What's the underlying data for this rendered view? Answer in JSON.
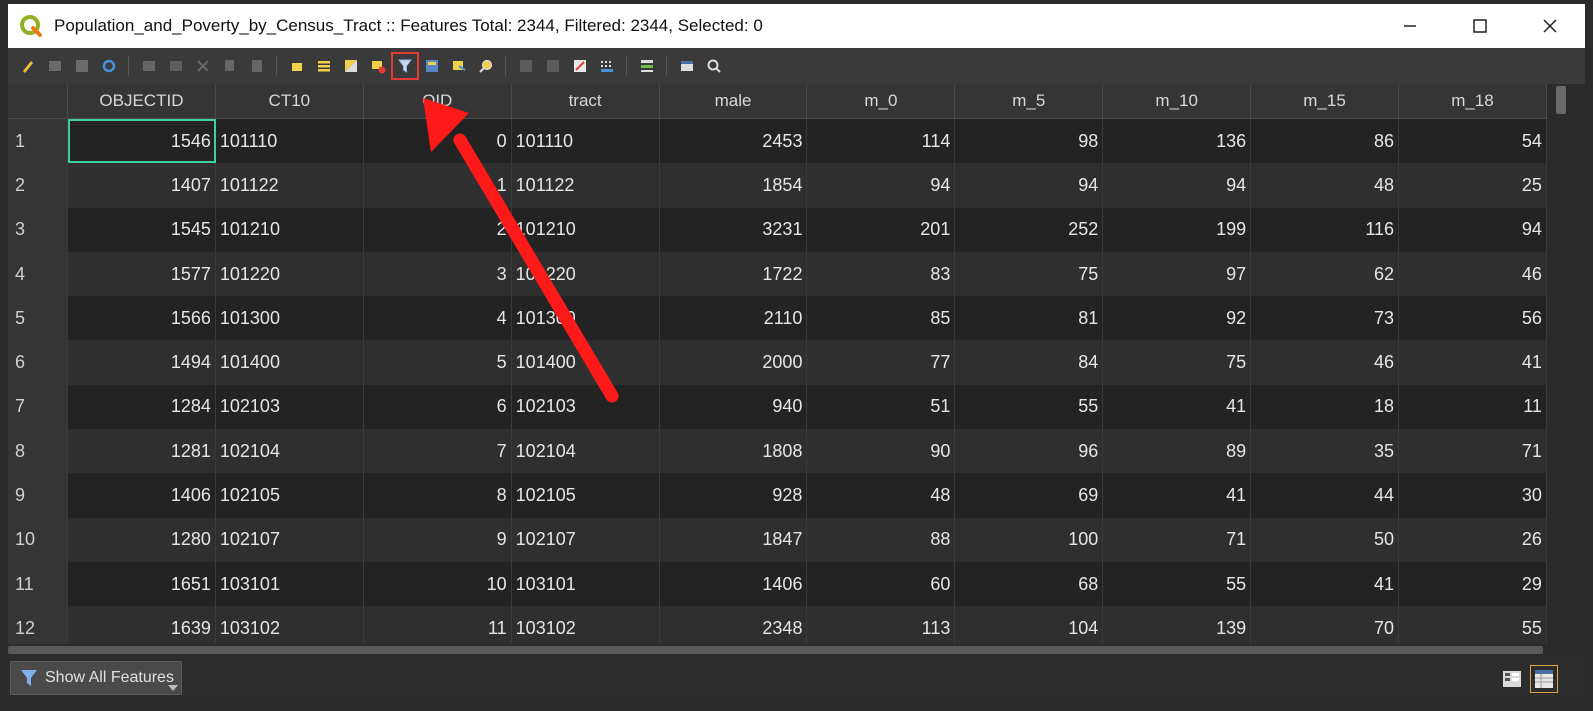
{
  "window": {
    "title": "Population_and_Poverty_by_Census_Tract :: Features Total: 2344, Filtered: 2344, Selected: 0",
    "app_icon": "qgis-icon",
    "controls": [
      "minimize-icon",
      "maximize-icon",
      "close-icon"
    ]
  },
  "toolbar": {
    "icons": [
      "toggle-editing-icon",
      "multi-edit-icon",
      "save-edits-icon",
      "reload-icon",
      "add-feature-icon",
      "delete-feature-icon",
      "cut-icon",
      "copy-icon",
      "paste-icon",
      "select-expression-icon",
      "select-all-icon",
      "invert-selection-icon",
      "deselect-all-icon",
      "filter-selected-to-top-icon",
      "move-selection-to-top-icon",
      "pan-to-selection-icon",
      "zoom-to-selection-icon",
      "new-field-icon",
      "delete-field-icon",
      "field-calculator-icon",
      "conditional-formatting-icon",
      "actions-icon",
      "dock-table-icon",
      "zoom-map-icon"
    ],
    "highlighted": "filter-selected-to-top-icon"
  },
  "table": {
    "columns": [
      "OBJECTID",
      "CT10",
      "OID",
      "tract",
      "male",
      "m_0",
      "m_5",
      "m_10",
      "m_15",
      "m_18"
    ],
    "rows": [
      {
        "n": "1",
        "cells": [
          "1546",
          "101110",
          "0",
          "101110",
          "2453",
          "114",
          "98",
          "136",
          "86",
          "54"
        ]
      },
      {
        "n": "2",
        "cells": [
          "1407",
          "101122",
          "1",
          "101122",
          "1854",
          "94",
          "94",
          "94",
          "48",
          "25"
        ]
      },
      {
        "n": "3",
        "cells": [
          "1545",
          "101210",
          "2",
          "101210",
          "3231",
          "201",
          "252",
          "199",
          "116",
          "94"
        ]
      },
      {
        "n": "4",
        "cells": [
          "1577",
          "101220",
          "3",
          "101220",
          "1722",
          "83",
          "75",
          "97",
          "62",
          "46"
        ]
      },
      {
        "n": "5",
        "cells": [
          "1566",
          "101300",
          "4",
          "101300",
          "2110",
          "85",
          "81",
          "92",
          "73",
          "56"
        ]
      },
      {
        "n": "6",
        "cells": [
          "1494",
          "101400",
          "5",
          "101400",
          "2000",
          "77",
          "84",
          "75",
          "46",
          "41"
        ]
      },
      {
        "n": "7",
        "cells": [
          "1284",
          "102103",
          "6",
          "102103",
          "940",
          "51",
          "55",
          "41",
          "18",
          "11"
        ]
      },
      {
        "n": "8",
        "cells": [
          "1281",
          "102104",
          "7",
          "102104",
          "1808",
          "90",
          "96",
          "89",
          "35",
          "71"
        ]
      },
      {
        "n": "9",
        "cells": [
          "1406",
          "102105",
          "8",
          "102105",
          "928",
          "48",
          "69",
          "41",
          "44",
          "30"
        ]
      },
      {
        "n": "10",
        "cells": [
          "1280",
          "102107",
          "9",
          "102107",
          "1847",
          "88",
          "100",
          "71",
          "50",
          "26"
        ]
      },
      {
        "n": "11",
        "cells": [
          "1651",
          "103101",
          "10",
          "103101",
          "1406",
          "60",
          "68",
          "55",
          "41",
          "29"
        ]
      },
      {
        "n": "12",
        "cells": [
          "1639",
          "103102",
          "11",
          "103102",
          "2348",
          "113",
          "104",
          "139",
          "70",
          "55"
        ]
      }
    ]
  },
  "bottom": {
    "show_all_label": "Show All Features",
    "view_icons": [
      "form-view-icon",
      "table-view-icon"
    ],
    "active_view": "table-view-icon"
  },
  "annotation": {
    "arrow_color": "#ff1a1a",
    "box_color": "#e53935"
  }
}
